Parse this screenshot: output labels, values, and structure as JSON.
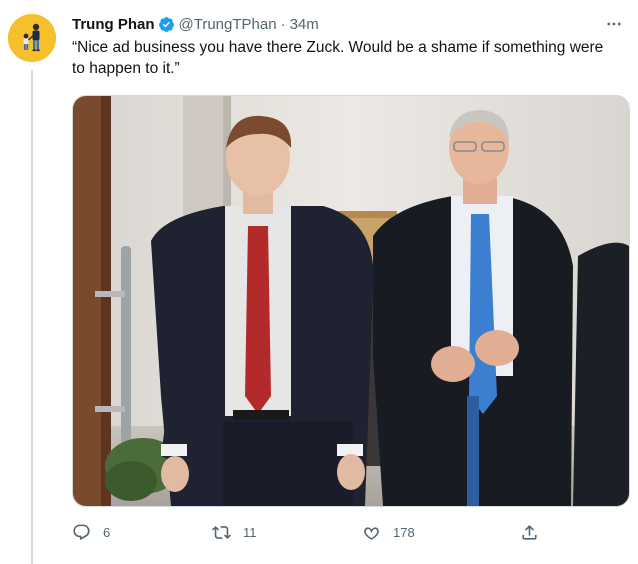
{
  "tweet": {
    "author_name": "Trung Phan",
    "handle": "@TrungTPhan",
    "separator": "·",
    "time": "34m",
    "text": "“Nice ad business you have there Zuck. Would be a shame if something were to happen to it.”",
    "media": {
      "description_icon": "photo"
    },
    "actions": {
      "replies": "6",
      "retweets": "11",
      "likes": "178"
    }
  },
  "icons": {
    "verified": "verified-badge-icon",
    "more": "more-dots-icon",
    "reply": "reply-icon",
    "retweet": "retweet-icon",
    "like": "heart-icon",
    "share": "share-icon"
  },
  "colors": {
    "accent": "#1d9bf0",
    "text": "#0f1419",
    "muted": "#536471",
    "avatar_bg": "#f5c02c"
  }
}
